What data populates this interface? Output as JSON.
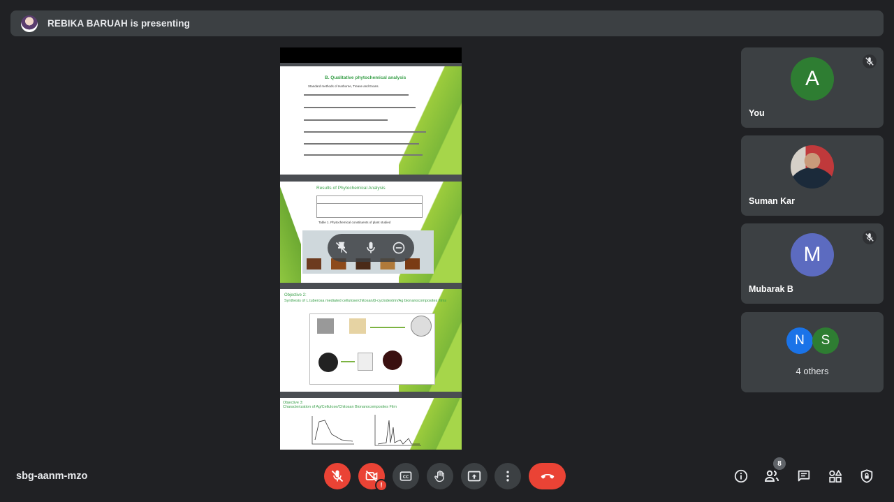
{
  "banner": {
    "presenter_text": "REBIKA BARUAH is presenting"
  },
  "slides": {
    "slide1_title": "B. Qualitative phytochemical analysis",
    "slide1_subtitle": "Standard methods of Harborne, Trease and Evans.",
    "slide2_title": "Results of Phytochemical Analysis",
    "slide2_caption": "Table 1. Phytochemical constituents of plant studied",
    "slide3_title": "Objective 2:",
    "slide3_sub": "Synthesis of L.tuberosa mediated cellulose/chitosan/β-cyclodextrin/Ag bionanocomposites films",
    "slide4_title": "Objective 3:",
    "slide4_sub": "Characterization of Ag/Cellulose/Chitosan Bionanocomposites Film"
  },
  "participants": [
    {
      "initial": "A",
      "name": "You",
      "color": "#2e7d32",
      "muted": true
    },
    {
      "initial": "",
      "name": "Suman Kar",
      "muted": false
    },
    {
      "initial": "M",
      "name": "Mubarak B",
      "color": "#5c6bc0",
      "muted": true
    }
  ],
  "others": {
    "initials": [
      "N",
      "S"
    ],
    "colors": [
      "#1a73e8",
      "#2e7d32"
    ],
    "label": "4 others"
  },
  "meeting": {
    "code": "sbg-aanm-mzo"
  },
  "people_count": "8",
  "icons": [
    "mic-off-icon",
    "camera-off-icon",
    "captions-icon",
    "raise-hand-icon",
    "present-icon",
    "more-icon",
    "hangup-icon",
    "info-icon",
    "people-icon",
    "chat-icon",
    "activities-icon",
    "host-controls-icon",
    "pin-icon",
    "remove-icon"
  ]
}
